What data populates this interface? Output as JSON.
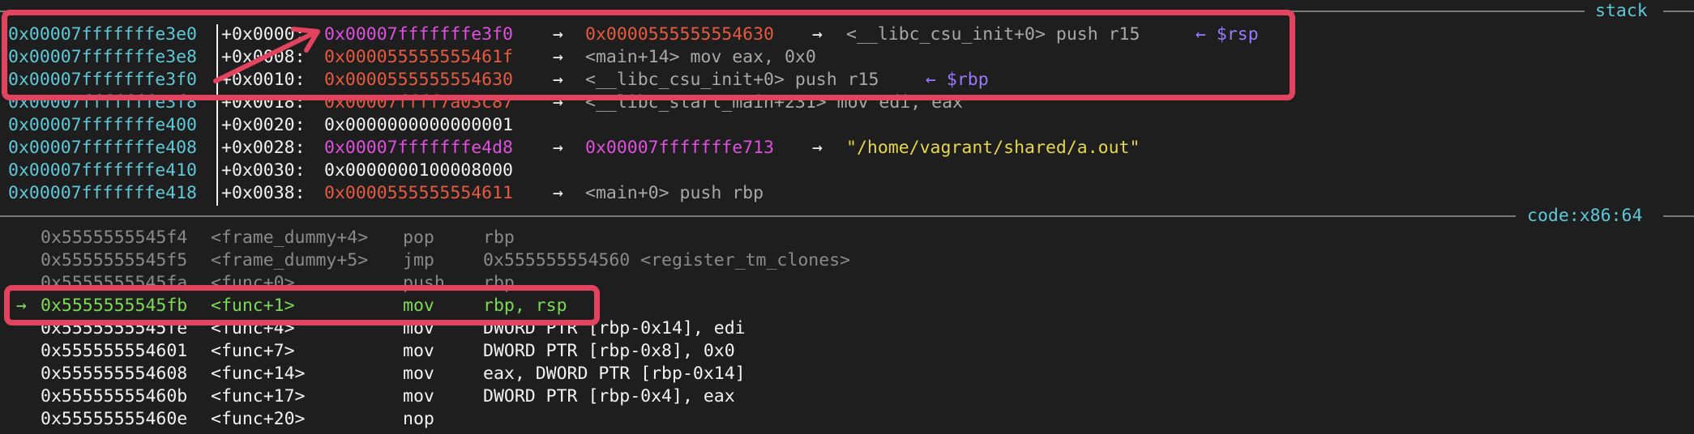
{
  "stack_header": {
    "title": "stack"
  },
  "stack_rows": [
    {
      "addr": "0x00007fffffffe3e0",
      "off": "+0x0000:",
      "val": "0x00007fffffffe3f0",
      "val_color": "magenta",
      "a1": "→",
      "v2": "0x0000555555554630",
      "v2_color": "red",
      "a2": "→",
      "desc": "<__libc_csu_init+0> push r15",
      "desc_color": "gray",
      "reg": "← $rsp"
    },
    {
      "addr": "0x00007fffffffe3e8",
      "off": "+0x0008:",
      "val": "0x000055555555461f",
      "val_color": "red",
      "a1": "→",
      "v2": "",
      "v2_color": "",
      "a2": "",
      "desc": "<main+14> mov eax, 0x0",
      "desc_color": "gray",
      "reg": ""
    },
    {
      "addr": "0x00007fffffffe3f0",
      "off": "+0x0010:",
      "val": "0x0000555555554630",
      "val_color": "red",
      "a1": "→",
      "v2": "",
      "v2_color": "",
      "a2": "",
      "desc": "<__libc_csu_init+0> push r15",
      "desc_color": "gray",
      "reg": "← $rbp"
    },
    {
      "addr": "0x00007fffffffe3f8",
      "off": "+0x0018:",
      "val": "0x00007ffff7a03c87",
      "val_color": "red",
      "a1": "→",
      "v2": "",
      "v2_color": "",
      "a2": "",
      "desc": "<__libc_start_main+231> mov edi, eax",
      "desc_color": "gray",
      "reg": ""
    },
    {
      "addr": "0x00007fffffffe400",
      "off": "+0x0020:",
      "val": "0x0000000000000001",
      "val_color": "white",
      "a1": "",
      "v2": "",
      "v2_color": "",
      "a2": "",
      "desc": "",
      "desc_color": "",
      "reg": ""
    },
    {
      "addr": "0x00007fffffffe408",
      "off": "+0x0028:",
      "val": "0x00007fffffffe4d8",
      "val_color": "magenta",
      "a1": "→",
      "v2": "0x00007fffffffe713",
      "v2_color": "magenta",
      "a2": "→",
      "desc": "\"/home/vagrant/shared/a.out\"",
      "desc_color": "yellow",
      "reg": ""
    },
    {
      "addr": "0x00007fffffffe410",
      "off": "+0x0030:",
      "val": "0x0000000100008000",
      "val_color": "white",
      "a1": "",
      "v2": "",
      "v2_color": "",
      "a2": "",
      "desc": "",
      "desc_color": "",
      "reg": ""
    },
    {
      "addr": "0x00007fffffffe418",
      "off": "+0x0038:",
      "val": "0x0000555555554611",
      "val_color": "red",
      "a1": "→",
      "v2": "",
      "v2_color": "",
      "a2": "",
      "desc": "<main+0> push rbp",
      "desc_color": "gray",
      "reg": ""
    }
  ],
  "code_header": {
    "title": "code:x86:64"
  },
  "code_rows": [
    {
      "marker": "",
      "addr": "0x5555555545f4",
      "sym": "<frame_dummy+4>",
      "op": "pop",
      "args": "rbp",
      "color": "dim"
    },
    {
      "marker": "",
      "addr": "0x5555555545f5",
      "sym": "<frame_dummy+5>",
      "op": "jmp",
      "args": "0x555555554560 <register_tm_clones>",
      "color": "dim"
    },
    {
      "marker": "",
      "addr": "0x5555555545fa",
      "sym": "<func+0>",
      "op": "push",
      "args": "rbp",
      "color": "dim"
    },
    {
      "marker": "→",
      "addr": "0x5555555545fb",
      "sym": "<func+1>",
      "op": "mov",
      "args": "rbp, rsp",
      "color": "green"
    },
    {
      "marker": "",
      "addr": "0x5555555545fe",
      "sym": "<func+4>",
      "op": "mov",
      "args": "DWORD PTR [rbp-0x14], edi",
      "color": "white"
    },
    {
      "marker": "",
      "addr": "0x555555554601",
      "sym": "<func+7>",
      "op": "mov",
      "args": "DWORD PTR [rbp-0x8], 0x0",
      "color": "white"
    },
    {
      "marker": "",
      "addr": "0x555555554608",
      "sym": "<func+14>",
      "op": "mov",
      "args": "eax, DWORD PTR [rbp-0x14]",
      "color": "white"
    },
    {
      "marker": "",
      "addr": "0x55555555460b",
      "sym": "<func+17>",
      "op": "mov",
      "args": "DWORD PTR [rbp-0x4], eax",
      "color": "white"
    },
    {
      "marker": "",
      "addr": "0x55555555460e",
      "sym": "<func+20>",
      "op": "nop",
      "args": "",
      "color": "white"
    }
  ],
  "annotations": {
    "highlight_color": "#e2435f"
  }
}
